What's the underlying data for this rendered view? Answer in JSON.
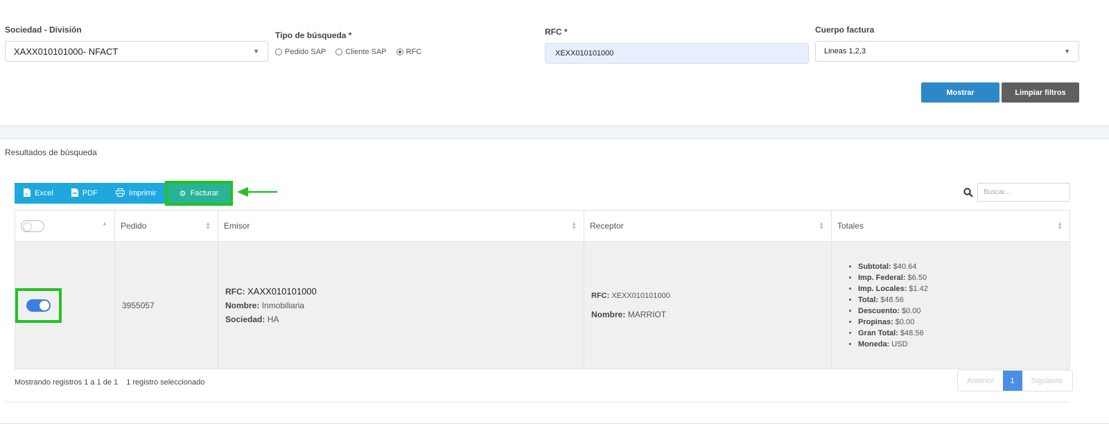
{
  "filters": {
    "sociedad": {
      "label": "Sociedad - División",
      "value": "XAXX010101000- NFACT"
    },
    "tipo_busqueda": {
      "label": "Tipo de búsqueda *",
      "options": [
        {
          "label": "Pedido SAP",
          "selected": false
        },
        {
          "label": "Cliente SAP",
          "selected": false
        },
        {
          "label": "RFC",
          "selected": true
        }
      ]
    },
    "rfc": {
      "label": "RFC *",
      "value": "XEXX010101000"
    },
    "cuerpo": {
      "label": "Cuerpo factura",
      "value": "Lineas 1,2,3"
    },
    "buttons": {
      "mostrar": "Mostrar",
      "limpiar": "Limpiar filtros"
    }
  },
  "results": {
    "title": "Resultados de búsqueda",
    "toolbar": {
      "excel": "Excel",
      "pdf": "PDF",
      "imprimir": "Imprimir",
      "facturar": "Facturar"
    },
    "search_placeholder": "Buscar...",
    "columns": [
      "Pedido",
      "Emisor",
      "Receptor",
      "Totales"
    ],
    "row": {
      "selected": true,
      "pedido": "3955057",
      "emisor": {
        "rfc_label": "RFC:",
        "rfc": "XAXX010101000",
        "nombre_label": "Nombre:",
        "nombre": "Inmobiliaria",
        "sociedad_label": "Sociedad:",
        "sociedad": "HA"
      },
      "receptor": {
        "rfc_label": "RFC:",
        "rfc": "XEXX010101000",
        "nombre_label": "Nombre:",
        "nombre": "MARRIOT"
      },
      "totales": [
        {
          "label": "Subtotal:",
          "value": "$40.64"
        },
        {
          "label": "Imp. Federal:",
          "value": "$6.50"
        },
        {
          "label": "Imp. Locales:",
          "value": "$1.42"
        },
        {
          "label": "Total:",
          "value": "$48.56"
        },
        {
          "label": "Descuento:",
          "value": "$0.00"
        },
        {
          "label": "Propinas:",
          "value": "$0.00"
        },
        {
          "label": "Gran Total:",
          "value": "$48.56"
        },
        {
          "label": "Moneda:",
          "value": "USD"
        }
      ]
    },
    "footer": {
      "showing": "Mostrando registros 1 a 1 de 1",
      "selected": "1 registro seleccionado"
    },
    "pager": {
      "prev": "Anterior",
      "page": "1",
      "next": "Siguiente"
    }
  },
  "colors": {
    "primary": "#2e87c7",
    "toolbar": "#1fa8de",
    "facturar": "#2bb39a",
    "highlight": "#22c322",
    "toggle_on": "#3d7fe0"
  }
}
